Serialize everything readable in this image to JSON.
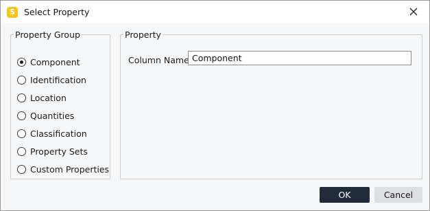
{
  "window": {
    "title": "Select Property",
    "app_icon_letter": "S",
    "close_icon": "close-icon"
  },
  "property_group": {
    "legend": "Property Group",
    "selected": "Component",
    "options": [
      {
        "label": "Component",
        "checked": true
      },
      {
        "label": "Identification",
        "checked": false
      },
      {
        "label": "Location",
        "checked": false
      },
      {
        "label": "Quantities",
        "checked": false
      },
      {
        "label": "Classification",
        "checked": false
      },
      {
        "label": "Property Sets",
        "checked": false
      },
      {
        "label": "Custom Properties",
        "checked": false
      }
    ]
  },
  "property": {
    "legend": "Property",
    "column_name_label": "Column Name",
    "column_name_value": "Component"
  },
  "buttons": {
    "ok": "OK",
    "cancel": "Cancel"
  },
  "colors": {
    "app_icon": "#f5c518",
    "ok_button": "#232b3a",
    "cancel_button": "#dcdee1",
    "background": "#f6f7f8"
  }
}
